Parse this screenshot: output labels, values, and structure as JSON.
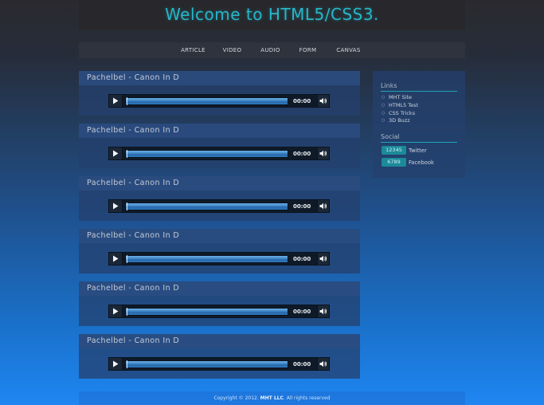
{
  "header": {
    "title": "Welcome to HTML5/CSS3."
  },
  "nav": {
    "items": [
      "ARTICLE",
      "VIDEO",
      "AUDIO",
      "FORM",
      "CANVAS"
    ]
  },
  "articles": [
    {
      "title": "Pachelbel - Canon In D",
      "time": "00:00"
    },
    {
      "title": "Pachelbel - Canon In D",
      "time": "00:00"
    },
    {
      "title": "Pachelbel - Canon In D",
      "time": "00:00"
    },
    {
      "title": "Pachelbel - Canon In D",
      "time": "00:00"
    },
    {
      "title": "Pachelbel - Canon In D",
      "time": "00:00"
    },
    {
      "title": "Pachelbel - Canon In D",
      "time": "00:00"
    }
  ],
  "audio": {
    "progress_fraction": 0,
    "icons": [
      "play-icon",
      "volume-icon"
    ]
  },
  "sidebar": {
    "links_heading": "Links",
    "links": [
      "MHT Site",
      "HTML5 Test",
      "CSS Tricks",
      "3D Buzz"
    ],
    "social_heading": "Social",
    "social": [
      {
        "count": "12345",
        "name": "Twitter"
      },
      {
        "count": "6789",
        "name": "Facebook"
      }
    ]
  },
  "footer": {
    "prefix": "Copyright © 2012. ",
    "company": "MHT LLC",
    "suffix": ". All rights reserved"
  },
  "colors": {
    "accent": "#26b6c8",
    "badge": "#1c8a99",
    "track": "#3d85c7"
  }
}
